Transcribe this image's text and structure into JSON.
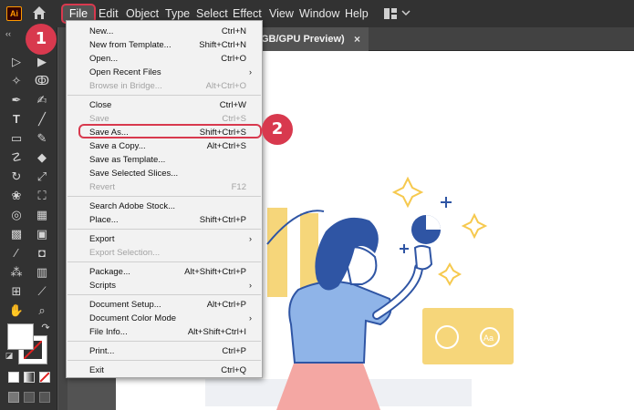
{
  "app": {
    "logo_text": "Ai"
  },
  "menubar": {
    "items": [
      "File",
      "Edit",
      "Object",
      "Type",
      "Select",
      "Effect",
      "View",
      "Window",
      "Help"
    ]
  },
  "document_tab": {
    "title": "GB/GPU Preview)",
    "close": "×"
  },
  "file_menu": {
    "items": [
      {
        "label": "New...",
        "shortcut": "Ctrl+N",
        "enabled": true
      },
      {
        "label": "New from Template...",
        "shortcut": "Shift+Ctrl+N",
        "enabled": true
      },
      {
        "label": "Open...",
        "shortcut": "Ctrl+O",
        "enabled": true
      },
      {
        "label": "Open Recent Files",
        "shortcut": "",
        "submenu": true,
        "enabled": true
      },
      {
        "label": "Browse in Bridge...",
        "shortcut": "Alt+Ctrl+O",
        "enabled": false
      },
      {
        "label": "Close",
        "shortcut": "Ctrl+W",
        "enabled": true
      },
      {
        "label": "Save",
        "shortcut": "Ctrl+S",
        "enabled": false
      },
      {
        "label": "Save As...",
        "shortcut": "Shift+Ctrl+S",
        "enabled": true
      },
      {
        "label": "Save a Copy...",
        "shortcut": "Alt+Ctrl+S",
        "enabled": true
      },
      {
        "label": "Save as Template...",
        "shortcut": "",
        "enabled": true
      },
      {
        "label": "Save Selected Slices...",
        "shortcut": "",
        "enabled": true
      },
      {
        "label": "Revert",
        "shortcut": "F12",
        "enabled": false
      },
      {
        "label": "Search Adobe Stock...",
        "shortcut": "",
        "enabled": true
      },
      {
        "label": "Place...",
        "shortcut": "Shift+Ctrl+P",
        "enabled": true
      },
      {
        "label": "Export",
        "shortcut": "",
        "submenu": true,
        "enabled": true
      },
      {
        "label": "Export Selection...",
        "shortcut": "",
        "enabled": false
      },
      {
        "label": "Package...",
        "shortcut": "Alt+Shift+Ctrl+P",
        "enabled": true
      },
      {
        "label": "Scripts",
        "shortcut": "",
        "submenu": true,
        "enabled": true
      },
      {
        "label": "Document Setup...",
        "shortcut": "Alt+Ctrl+P",
        "enabled": true
      },
      {
        "label": "Document Color Mode",
        "shortcut": "",
        "submenu": true,
        "enabled": true
      },
      {
        "label": "File Info...",
        "shortcut": "Alt+Shift+Ctrl+I",
        "enabled": true
      },
      {
        "label": "Print...",
        "shortcut": "Ctrl+P",
        "enabled": true
      },
      {
        "label": "Exit",
        "shortcut": "Ctrl+Q",
        "enabled": true
      }
    ],
    "submenu_arrow": "›"
  },
  "steps": {
    "step1": "1",
    "step2": "2"
  },
  "colors": {
    "accent_red": "#d8394e",
    "illustration_blue": "#2f55a4",
    "illustration_yellow": "#f6d67a",
    "illustration_pink": "#f4a7a3"
  }
}
